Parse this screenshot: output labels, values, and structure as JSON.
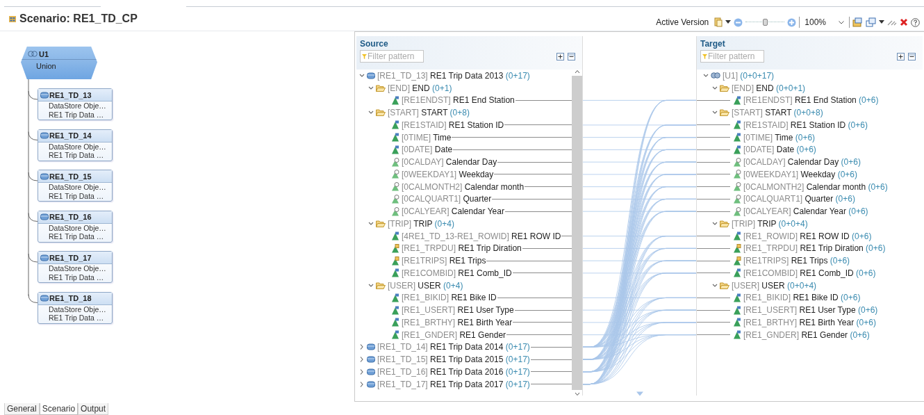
{
  "header": {
    "title": "Scenario: RE1_TD_CP"
  },
  "toolbar": {
    "version_label": "Active Version",
    "zoom": {
      "level": 0.5
    },
    "zoom_value": "100%"
  },
  "diagram": {
    "union": {
      "name": "U1",
      "type": "Union"
    },
    "sources": [
      {
        "name": "RE1_TD_13",
        "line_1": "DataStore Obje…",
        "line_2": "RE1 Trip Data …"
      },
      {
        "name": "RE1_TD_14",
        "line_1": "DataStore Obje…",
        "line_2": "RE1 Trip Data …"
      },
      {
        "name": "RE1_TD_15",
        "line_1": "DataStore Obje…",
        "line_2": "RE1 Trip Data …"
      },
      {
        "name": "RE1_TD_16",
        "line_1": "DataStore Obje…",
        "line_2": "RE1 Trip Data …"
      },
      {
        "name": "RE1_TD_17",
        "line_1": "DataStore Obje…",
        "line_2": "RE1 Trip Data …"
      },
      {
        "name": "RE1_TD_18",
        "line_1": "DataStore Obje…",
        "line_2": "RE1 Trip Data …"
      }
    ]
  },
  "source": {
    "title": "Source",
    "filter": {
      "placeholder": "Filter pattern"
    },
    "tree": [
      {
        "kind": "datastore",
        "code": "[RE1_TD_13]",
        "name": "RE1 Trip Data 2013",
        "count": "(0+17)",
        "expanded": true,
        "children": [
          {
            "kind": "folder",
            "code": "[END]",
            "name": "END",
            "count": "(0+1)",
            "expanded": true,
            "children": [
              {
                "kind": "characteristic",
                "code": "[RE1ENDST]",
                "name": "RE1 End Station"
              }
            ]
          },
          {
            "kind": "folder",
            "code": "[START]",
            "name": "START",
            "count": "(0+8)",
            "expanded": true,
            "children": [
              {
                "kind": "characteristic",
                "code": "[RE1STAID]",
                "name": "RE1 Station ID"
              },
              {
                "kind": "characteristic",
                "code": "[0TIME]",
                "name": "Time"
              },
              {
                "kind": "characteristic",
                "code": "[0DATE]",
                "name": "Date"
              },
              {
                "kind": "time",
                "code": "[0CALDAY]",
                "name": "Calendar Day"
              },
              {
                "kind": "time",
                "code": "[0WEEKDAY1]",
                "name": "Weekday"
              },
              {
                "kind": "time",
                "code": "[0CALMONTH2]",
                "name": "Calendar month"
              },
              {
                "kind": "time",
                "code": "[0CALQUART1]",
                "name": "Quarter"
              },
              {
                "kind": "time",
                "code": "[0CALYEAR]",
                "name": "Calendar Year"
              }
            ]
          },
          {
            "kind": "folder",
            "code": "[TRIP]",
            "name": "TRIP",
            "count": "(0+4)",
            "expanded": true,
            "children": [
              {
                "kind": "characteristic",
                "code": "[4RE1_TD_13-RE1_ROWID]",
                "name": "RE1 ROW ID"
              },
              {
                "kind": "keyfigure",
                "code": "[RE1_TRPDU]",
                "name": "RE1 Trip Diration"
              },
              {
                "kind": "keyfigure",
                "code": "[RE1TRIPS]",
                "name": "RE1 Trips"
              },
              {
                "kind": "characteristic",
                "code": "[RE1COMBID]",
                "name": "RE1 Comb_ID"
              }
            ]
          },
          {
            "kind": "folder",
            "code": "[USER]",
            "name": "USER",
            "count": "(0+4)",
            "expanded": true,
            "children": [
              {
                "kind": "characteristic",
                "code": "[RE1_BIKID]",
                "name": "RE1 Bike ID"
              },
              {
                "kind": "characteristic",
                "code": "[RE1_USERT]",
                "name": "RE1 User Type"
              },
              {
                "kind": "characteristic",
                "code": "[RE1_BRTHY]",
                "name": "RE1 Birth Year"
              },
              {
                "kind": "characteristic",
                "code": "[RE1_GNDER]",
                "name": "RE1 Gender"
              }
            ]
          }
        ]
      },
      {
        "kind": "datastore",
        "code": "[RE1_TD_14]",
        "name": "RE1 Trip Data 2014",
        "count": "(0+17)",
        "expanded": false
      },
      {
        "kind": "datastore",
        "code": "[RE1_TD_15]",
        "name": "RE1 Trip Data 2015",
        "count": "(0+17)",
        "expanded": false
      },
      {
        "kind": "datastore",
        "code": "[RE1_TD_16]",
        "name": "RE1 Trip Data 2016",
        "count": "(0+17)",
        "expanded": false
      },
      {
        "kind": "datastore",
        "code": "[RE1_TD_17]",
        "name": "RE1 Trip Data 2017",
        "count": "(0+17)",
        "expanded": false
      }
    ]
  },
  "target": {
    "title": "Target",
    "filter": {
      "placeholder": "Filter pattern"
    },
    "tree": [
      {
        "kind": "union",
        "code": "[U1]",
        "count": "(0+0+17)",
        "expanded": true,
        "children": [
          {
            "kind": "folder",
            "code": "[END]",
            "name": "END",
            "count": "(0+0+1)",
            "expanded": true,
            "children": [
              {
                "kind": "characteristic",
                "code": "[RE1ENDST]",
                "name": "RE1 End Station",
                "count": "(0+6)"
              }
            ]
          },
          {
            "kind": "folder",
            "code": "[START]",
            "name": "START",
            "count": "(0+0+8)",
            "expanded": true,
            "children": [
              {
                "kind": "characteristic",
                "code": "[RE1STAID]",
                "name": "RE1 Station ID",
                "count": "(0+6)"
              },
              {
                "kind": "characteristic",
                "code": "[0TIME]",
                "name": "Time",
                "count": "(0+6)"
              },
              {
                "kind": "characteristic",
                "code": "[0DATE]",
                "name": "Date",
                "count": "(0+6)"
              },
              {
                "kind": "time",
                "code": "[0CALDAY]",
                "name": "Calendar Day",
                "count": "(0+6)"
              },
              {
                "kind": "time",
                "code": "[0WEEKDAY1]",
                "name": "Weekday",
                "count": "(0+6)"
              },
              {
                "kind": "time",
                "code": "[0CALMONTH2]",
                "name": "Calendar month",
                "count": "(0+6)"
              },
              {
                "kind": "time",
                "code": "[0CALQUART1]",
                "name": "Quarter",
                "count": "(0+6)"
              },
              {
                "kind": "time",
                "code": "[0CALYEAR]",
                "name": "Calendar Year",
                "count": "(0+6)"
              }
            ]
          },
          {
            "kind": "folder",
            "code": "[TRIP]",
            "name": "TRIP",
            "count": "(0+0+4)",
            "expanded": true,
            "children": [
              {
                "kind": "characteristic",
                "code": "[RE1_ROWID]",
                "name": "RE1 ROW ID",
                "count": "(0+6)"
              },
              {
                "kind": "keyfigure",
                "code": "[RE1_TRPDU]",
                "name": "RE1 Trip Diration",
                "count": "(0+6)"
              },
              {
                "kind": "keyfigure",
                "code": "[RE1TRIPS]",
                "name": "RE1 Trips",
                "count": "(0+6)"
              },
              {
                "kind": "characteristic",
                "code": "[RE1COMBID]",
                "name": "RE1 Comb_ID",
                "count": "(0+6)"
              }
            ]
          },
          {
            "kind": "folder",
            "code": "[USER]",
            "name": "USER",
            "count": "(0+0+4)",
            "expanded": true,
            "children": [
              {
                "kind": "characteristic",
                "code": "[RE1_BIKID]",
                "name": "RE1 Bike ID",
                "count": "(0+6)"
              },
              {
                "kind": "characteristic",
                "code": "[RE1_USERT]",
                "name": "RE1 User Type",
                "count": "(0+6)"
              },
              {
                "kind": "characteristic",
                "code": "[RE1_BRTHY]",
                "name": "RE1 Birth Year",
                "count": "(0+6)"
              },
              {
                "kind": "characteristic",
                "code": "[RE1_GNDER]",
                "name": "RE1 Gender",
                "count": "(0+6)"
              }
            ]
          }
        ]
      }
    ]
  },
  "tabs": [
    {
      "label": "General",
      "selected": false
    },
    {
      "label": "Scenario",
      "selected": true
    },
    {
      "label": "Output",
      "selected": false
    }
  ]
}
